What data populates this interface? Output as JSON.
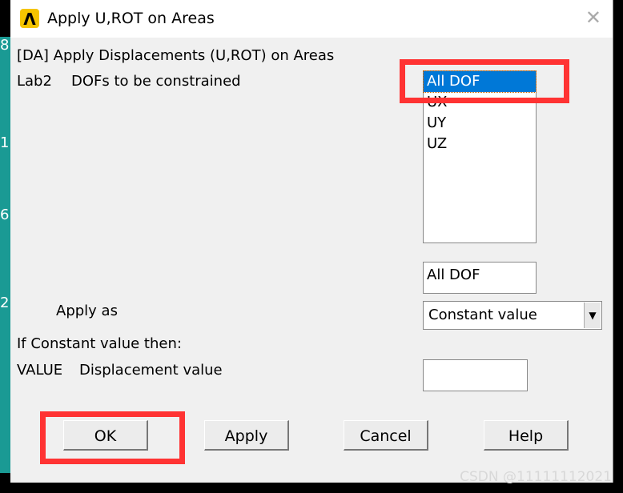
{
  "window": {
    "title": "Apply U,ROT on Areas",
    "close": "✕",
    "logo": "Λ"
  },
  "background_labels": [
    "8",
    "1",
    "6",
    "2"
  ],
  "header": "[DA]  Apply Displacements (U,ROT) on Areas",
  "lab2": {
    "code": "Lab2",
    "label": "DOFs to be constrained",
    "options": [
      "All DOF",
      "UX",
      "UY",
      "UZ"
    ],
    "selected": "All DOF",
    "field_value": "All DOF"
  },
  "apply_as": {
    "label": "Apply as",
    "value": "Constant value"
  },
  "if_constant": "If Constant value then:",
  "value_row": {
    "code": "VALUE",
    "label": "Displacement value",
    "value": ""
  },
  "buttons": {
    "ok": "OK",
    "apply": "Apply",
    "cancel": "Cancel",
    "help": "Help"
  },
  "highlight_color": "#ff3333",
  "selection_color": "#0078d7",
  "watermark": "CSDN @11111112021"
}
